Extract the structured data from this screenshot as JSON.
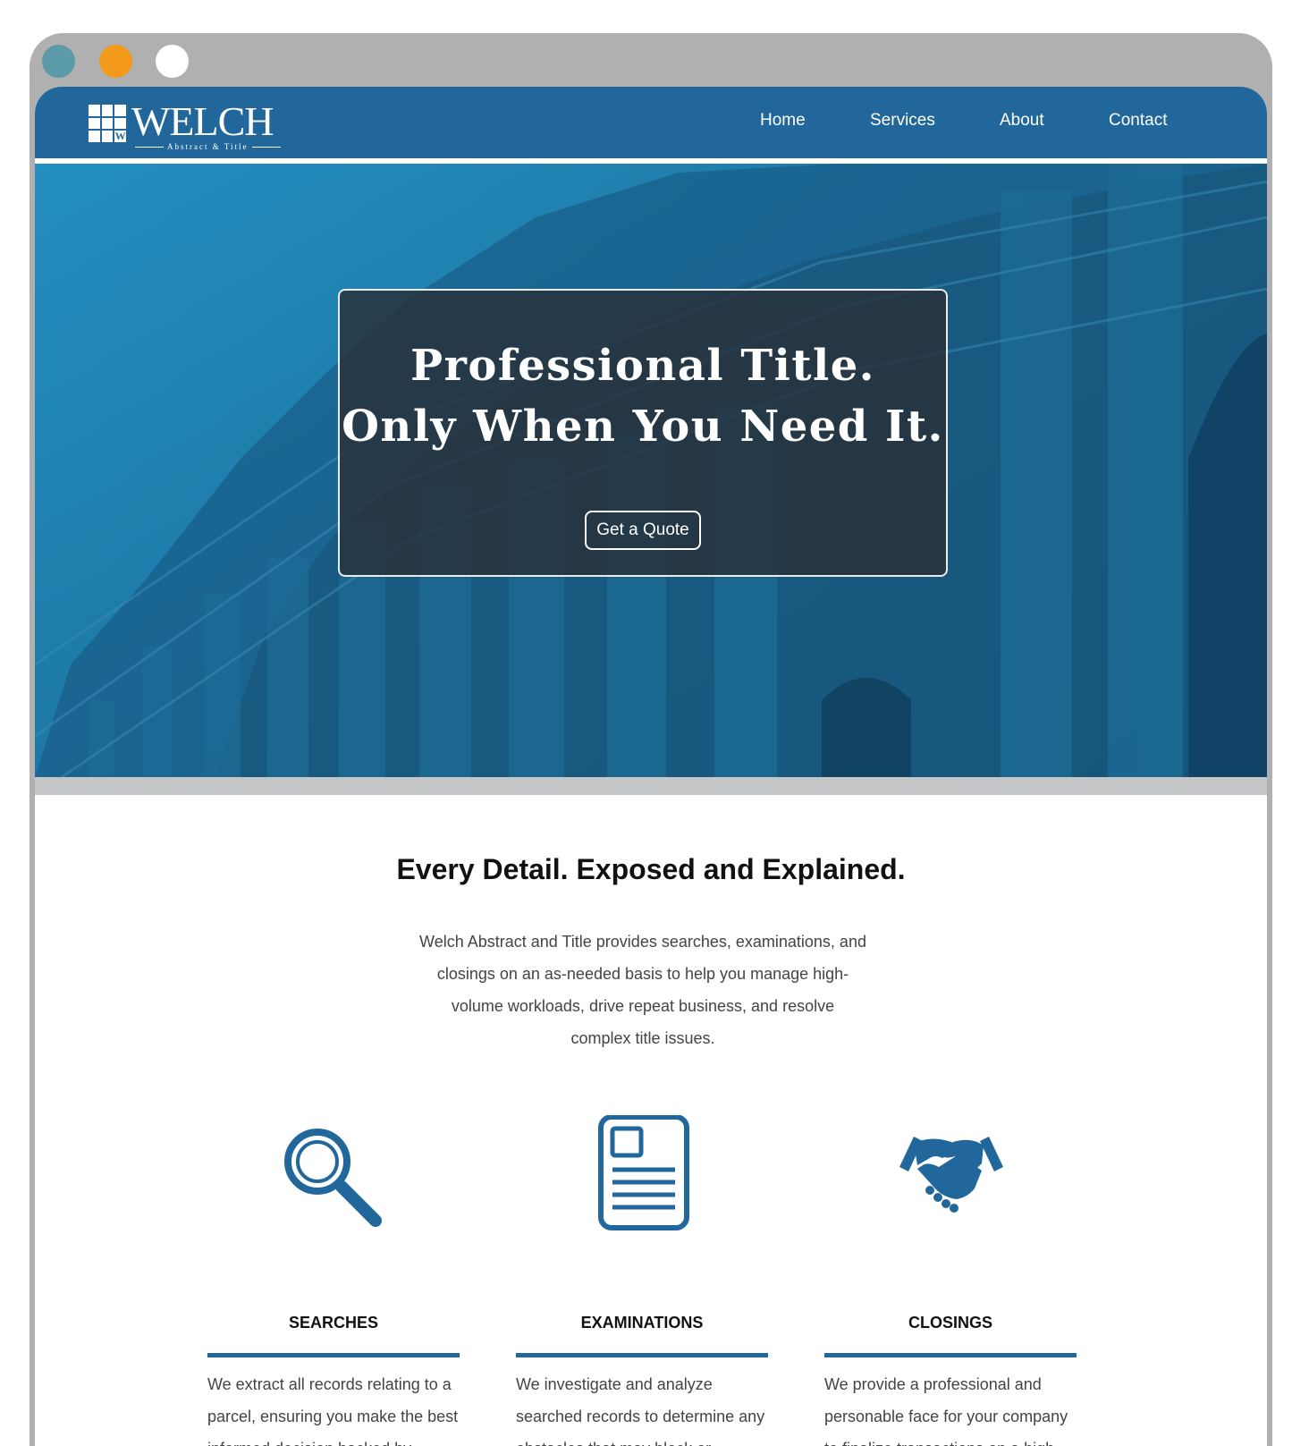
{
  "colors": {
    "frame": "#b0b0b0",
    "traffic_lights": [
      "#5b9aa8",
      "#f39a1d",
      "#ffffff"
    ],
    "brand_blue": "#22679b",
    "hero_overlay": "#1c6f9c",
    "hero_box": "#283038",
    "band_gray": "#c4c6c8"
  },
  "logo": {
    "name": "WELCH",
    "subtitle": "Abstract & Title",
    "mark_letter": "W"
  },
  "nav": {
    "items": [
      {
        "label": "Home"
      },
      {
        "label": "Services"
      },
      {
        "label": "About"
      },
      {
        "label": "Contact"
      }
    ]
  },
  "hero": {
    "line1": "Professional Title.",
    "line2": "Only When You Need It.",
    "cta": "Get a Quote"
  },
  "intro": {
    "heading": "Every Detail. Exposed and Explained.",
    "body": "Welch Abstract and Title provides searches, examinations, and closings on an as-needed basis to help you manage high-volume workloads, drive repeat business, and resolve complex title issues."
  },
  "services": [
    {
      "title": "SEARCHES",
      "icon": "magnifying-glass-icon",
      "text": "We extract all records relating to a parcel, ensuring you make the best informed decision backed by"
    },
    {
      "title": "EXAMINATIONS",
      "icon": "document-icon",
      "text": "We investigate and analyze searched records to determine any obstacles that may block or"
    },
    {
      "title": "CLOSINGS",
      "icon": "handshake-icon",
      "text": "We provide a professional and personable face for your company to finalize transactions on a high"
    }
  ]
}
